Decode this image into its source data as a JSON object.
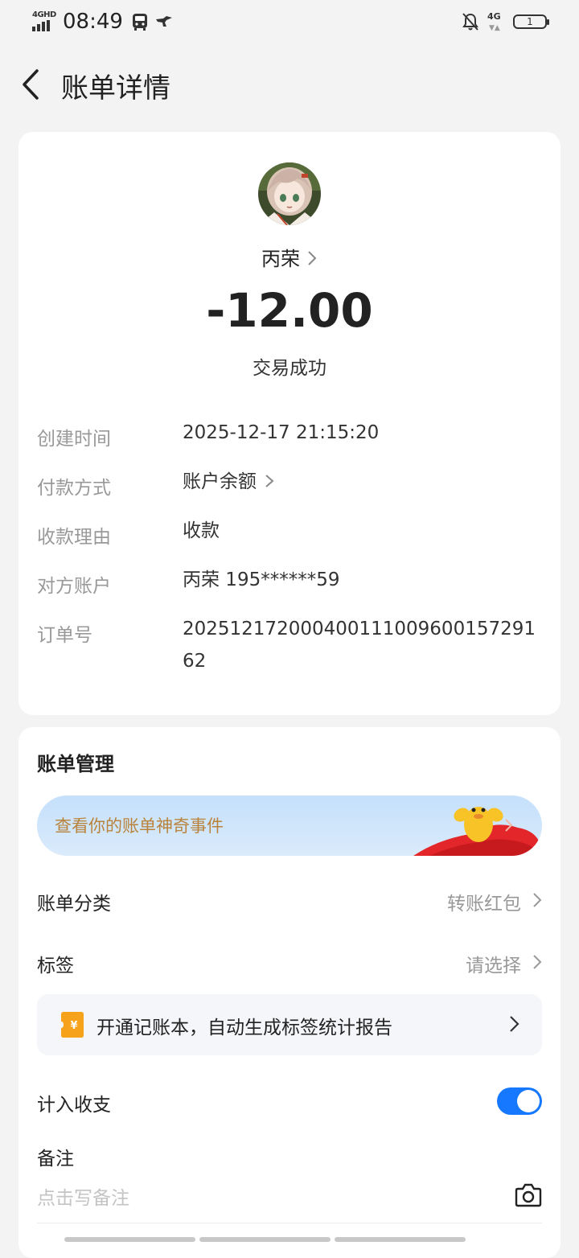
{
  "status_bar": {
    "network_type": "4GHD",
    "time": "08:49",
    "network_right": "4G",
    "battery": "1"
  },
  "header": {
    "title": "账单详情"
  },
  "transaction": {
    "payee": "丙荣",
    "amount": "-12.00",
    "status": "交易成功",
    "details": [
      {
        "label": "创建时间",
        "value": "2025-12-17 21:15:20"
      },
      {
        "label": "付款方式",
        "value": "账户余额"
      },
      {
        "label": "收款理由",
        "value": "收款"
      },
      {
        "label": "对方账户",
        "value": "丙荣 195******59"
      },
      {
        "label": "订单号",
        "value": "2025121720004001110096001572​9162"
      }
    ]
  },
  "management": {
    "title": "账单管理",
    "banner_text": "查看你的账单神奇事件",
    "category_label": "账单分类",
    "category_value": "转账红包",
    "tag_label": "标签",
    "tag_value": "请选择",
    "promo_text": "开通记账本，自动生成标签统计报告",
    "include_label": "计入收支",
    "include_enabled": true,
    "note_label": "备注",
    "note_placeholder": "点击写备注"
  },
  "colors": {
    "accent": "#1677ff",
    "banner_text": "#b9833c",
    "promo_icon": "#f7a21b"
  }
}
